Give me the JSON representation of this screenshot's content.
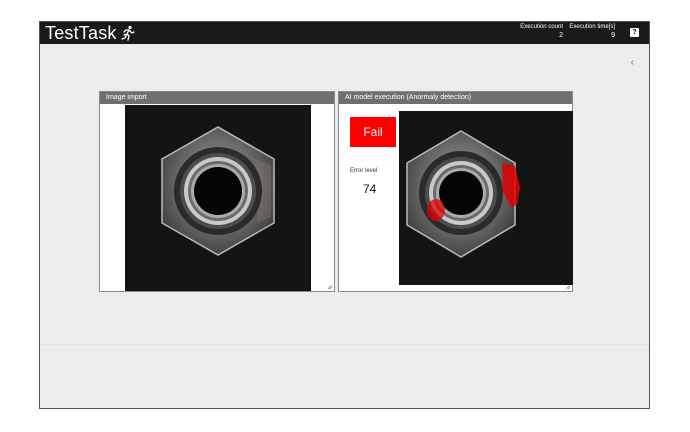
{
  "app": {
    "title": "TestTask",
    "title_icon": "running-person-icon"
  },
  "header": {
    "execution_count": {
      "label": "Execution count",
      "value": "2"
    },
    "execution_time": {
      "label": "Execution time[s]",
      "value": "9"
    },
    "help_label": "?"
  },
  "collapse_label": "‹",
  "panels": {
    "import": {
      "title": "Image import"
    },
    "ai": {
      "title": "AI model execution (Anormaly detection)",
      "result": "Fail",
      "result_color": "#ff0000",
      "error_level_label": "Error level",
      "error_level_value": "74"
    }
  },
  "colors": {
    "topbar": "#1a1a1a",
    "panel_header": "#6f6f6f",
    "background": "#ececec",
    "anomaly": "#e00000"
  }
}
